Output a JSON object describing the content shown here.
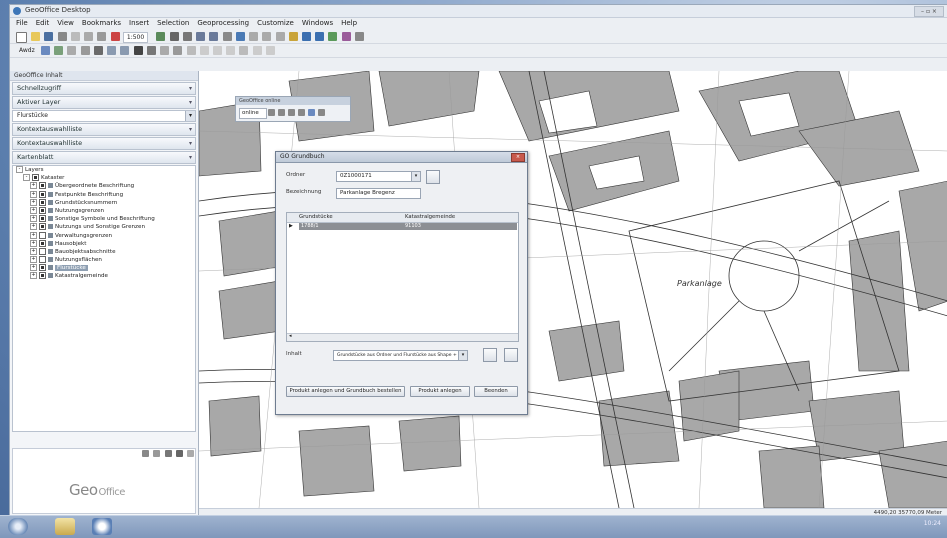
{
  "window": {
    "title": "GeoOffice Desktop"
  },
  "menu": [
    "File",
    "Edit",
    "View",
    "Bookmarks",
    "Insert",
    "Selection",
    "Geoprocessing",
    "Customize",
    "Windows",
    "Help"
  ],
  "toolbar": {
    "scale": "1:500",
    "search_label": "Awdz"
  },
  "left_pane": {
    "title": "GeoOffice Inhalt",
    "sections": [
      {
        "label": "Schnellzugriff"
      },
      {
        "label": "Aktiver Layer"
      },
      {
        "label": "Kontextauswahlliste"
      },
      {
        "label": "Kontextauswahlliste"
      },
      {
        "label": "Kartenblatt"
      }
    ],
    "field_value": "Flurstücke",
    "tree": [
      {
        "label": "Layers",
        "level": 0,
        "toggle": "-",
        "checked": null
      },
      {
        "label": "Kataster",
        "level": 1,
        "toggle": "-",
        "checked": true
      },
      {
        "label": "Übergeordnete Beschriftung",
        "level": 2,
        "toggle": "+",
        "checked": true
      },
      {
        "label": "Festpunkte Beschriftung",
        "level": 2,
        "toggle": "+",
        "checked": true
      },
      {
        "label": "Grundstücksnummern",
        "level": 2,
        "toggle": "+",
        "checked": true
      },
      {
        "label": "Nutzungsgrenzen",
        "level": 2,
        "toggle": "+",
        "checked": true
      },
      {
        "label": "Sonstige Symbole und Beschriftung",
        "level": 2,
        "toggle": "+",
        "checked": true
      },
      {
        "label": "Nutzungs und Sonstige Grenzen",
        "level": 2,
        "toggle": "+",
        "checked": true
      },
      {
        "label": "Verwaltungsgrenzen",
        "level": 2,
        "toggle": "+",
        "checked": false
      },
      {
        "label": "Hausobjekt",
        "level": 2,
        "toggle": "+",
        "checked": true
      },
      {
        "label": "Bauobjektsabschnitte",
        "level": 2,
        "toggle": "+",
        "checked": false
      },
      {
        "label": "Nutzungsflächen",
        "level": 2,
        "toggle": "+",
        "checked": false
      },
      {
        "label": "Flurstücke",
        "level": 2,
        "toggle": "+",
        "checked": true,
        "selected": true
      },
      {
        "label": "Katastralgemeinde",
        "level": 2,
        "toggle": "+",
        "checked": true
      }
    ],
    "logo": {
      "geo": "Geo",
      "office": "Office"
    }
  },
  "float_toolbar": {
    "title": "GeoOffice online",
    "select_value": "online"
  },
  "dialog": {
    "title": "GO Grundbuch",
    "field1_label": "Ordner",
    "field1_value": "0Z1000171",
    "field2_label": "Bezeichnung",
    "field2_value": "Parkanlage Bregenz",
    "columns": [
      "Grundstücke",
      "Katastralgemeinde"
    ],
    "rows": [
      {
        "col1": "1788/1",
        "col2": "91103"
      }
    ],
    "bottom_label": "Inhalt",
    "bottom_value": "Grundstücke aus Ordner und Flurstücke aus Shape + CHF",
    "buttons": [
      "Produkt anlegen und Grundbuch bestellen",
      "Produkt anlegen",
      "Beenden"
    ]
  },
  "map": {
    "label": "Parkanlage"
  },
  "status": {
    "coords": "4490,20 35770,09 Meter"
  },
  "taskbar": {
    "clock": "10:24"
  },
  "colors": {
    "parcel": "#a8a8a8",
    "line": "#333333",
    "window_bg": "#eceff3",
    "selected_row": "#8c8f94"
  }
}
